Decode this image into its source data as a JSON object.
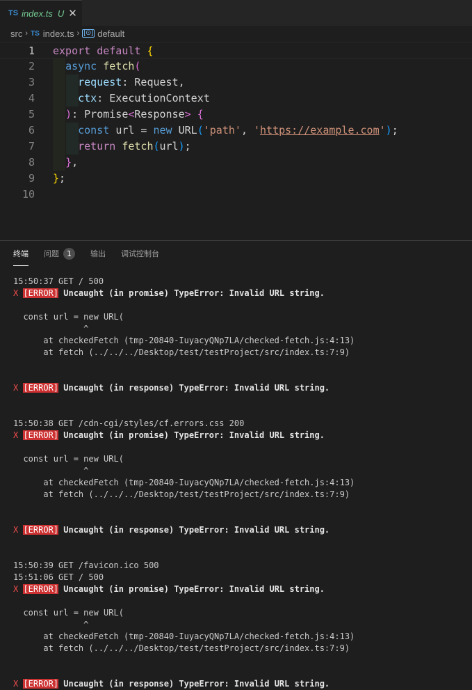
{
  "tab": {
    "badge": "TS",
    "filename": "index.ts",
    "status": "U",
    "close": "✕"
  },
  "breadcrumb": {
    "folder": "src",
    "file_badge": "TS",
    "file": "index.ts",
    "symbol_icon": "[⊙]",
    "symbol": "default"
  },
  "editor": {
    "line_numbers": [
      "1",
      "2",
      "3",
      "4",
      "5",
      "6",
      "7",
      "8",
      "9",
      "10"
    ],
    "active_line": 1,
    "lines": [
      [
        {
          "t": "export ",
          "c": "ctl"
        },
        {
          "t": "default ",
          "c": "ctl"
        },
        {
          "t": "{",
          "c": "br1"
        }
      ],
      [
        {
          "t": "  "
        },
        {
          "t": "async ",
          "c": "kw"
        },
        {
          "t": "fetch",
          "c": "fn"
        },
        {
          "t": "(",
          "c": "br2"
        }
      ],
      [
        {
          "t": "    "
        },
        {
          "t": "request",
          "c": "param"
        },
        {
          "t": ": ",
          "c": "plain"
        },
        {
          "t": "Request",
          "c": "plain"
        },
        {
          "t": ",",
          "c": "plain"
        }
      ],
      [
        {
          "t": "    "
        },
        {
          "t": "ctx",
          "c": "param"
        },
        {
          "t": ": ",
          "c": "plain"
        },
        {
          "t": "ExecutionContext",
          "c": "plain"
        }
      ],
      [
        {
          "t": "  "
        },
        {
          "t": ")",
          "c": "br2"
        },
        {
          "t": ": ",
          "c": "plain"
        },
        {
          "t": "Promise",
          "c": "plain"
        },
        {
          "t": "<",
          "c": "br2"
        },
        {
          "t": "Response",
          "c": "plain"
        },
        {
          "t": ">",
          "c": "br2"
        },
        {
          "t": " ",
          "c": "plain"
        },
        {
          "t": "{",
          "c": "br2"
        }
      ],
      [
        {
          "t": "    "
        },
        {
          "t": "const ",
          "c": "kw"
        },
        {
          "t": "url",
          "c": "plain"
        },
        {
          "t": " = ",
          "c": "plain"
        },
        {
          "t": "new ",
          "c": "kw"
        },
        {
          "t": "URL",
          "c": "plain"
        },
        {
          "t": "(",
          "c": "br3"
        },
        {
          "t": "'path'",
          "c": "str"
        },
        {
          "t": ", ",
          "c": "plain"
        },
        {
          "t": "'",
          "c": "str"
        },
        {
          "t": "https://example.com",
          "c": "str uline"
        },
        {
          "t": "'",
          "c": "str"
        },
        {
          "t": ")",
          "c": "br3"
        },
        {
          "t": ";",
          "c": "plain"
        }
      ],
      [
        {
          "t": "    "
        },
        {
          "t": "return ",
          "c": "ctl"
        },
        {
          "t": "fetch",
          "c": "fn"
        },
        {
          "t": "(",
          "c": "br3"
        },
        {
          "t": "url",
          "c": "plain"
        },
        {
          "t": ")",
          "c": "br3"
        },
        {
          "t": ";",
          "c": "plain"
        }
      ],
      [
        {
          "t": "  "
        },
        {
          "t": "}",
          "c": "br2"
        },
        {
          "t": ",",
          "c": "plain"
        }
      ],
      [
        {
          "t": "}",
          "c": "br1"
        },
        {
          "t": ";",
          "c": "plain"
        }
      ],
      []
    ]
  },
  "panel": {
    "tabs": [
      {
        "label": "终端",
        "active": true
      },
      {
        "label": "问题",
        "badge": "1"
      },
      {
        "label": "输出"
      },
      {
        "label": "调试控制台"
      }
    ]
  },
  "terminal": {
    "lines": [
      {
        "kind": "log",
        "text": "15:50:37 GET / 500"
      },
      {
        "kind": "error",
        "x": "X",
        "badge": "[ERROR]",
        "msg": "Uncaught (in promise) TypeError: Invalid URL string."
      },
      {
        "kind": "blank"
      },
      {
        "kind": "plain",
        "text": "  const url = new URL("
      },
      {
        "kind": "plain",
        "text": "              ^"
      },
      {
        "kind": "plain",
        "text": "      at checkedFetch (tmp-20840-IuyacyQNp7LA/checked-fetch.js:4:13)"
      },
      {
        "kind": "plain",
        "text": "      at fetch (../../../Desktop/test/testProject/src/index.ts:7:9)"
      },
      {
        "kind": "blank"
      },
      {
        "kind": "blank"
      },
      {
        "kind": "error",
        "x": "X",
        "badge": "[ERROR]",
        "msg": "Uncaught (in response) TypeError: Invalid URL string."
      },
      {
        "kind": "blank"
      },
      {
        "kind": "blank"
      },
      {
        "kind": "log",
        "text": "15:50:38 GET /cdn-cgi/styles/cf.errors.css 200"
      },
      {
        "kind": "error",
        "x": "X",
        "badge": "[ERROR]",
        "msg": "Uncaught (in promise) TypeError: Invalid URL string."
      },
      {
        "kind": "blank"
      },
      {
        "kind": "plain",
        "text": "  const url = new URL("
      },
      {
        "kind": "plain",
        "text": "              ^"
      },
      {
        "kind": "plain",
        "text": "      at checkedFetch (tmp-20840-IuyacyQNp7LA/checked-fetch.js:4:13)"
      },
      {
        "kind": "plain",
        "text": "      at fetch (../../../Desktop/test/testProject/src/index.ts:7:9)"
      },
      {
        "kind": "blank"
      },
      {
        "kind": "blank"
      },
      {
        "kind": "error",
        "x": "X",
        "badge": "[ERROR]",
        "msg": "Uncaught (in response) TypeError: Invalid URL string."
      },
      {
        "kind": "blank"
      },
      {
        "kind": "blank"
      },
      {
        "kind": "log",
        "text": "15:50:39 GET /favicon.ico 500"
      },
      {
        "kind": "log",
        "text": "15:51:06 GET / 500"
      },
      {
        "kind": "error",
        "x": "X",
        "badge": "[ERROR]",
        "msg": "Uncaught (in promise) TypeError: Invalid URL string."
      },
      {
        "kind": "blank"
      },
      {
        "kind": "plain",
        "text": "  const url = new URL("
      },
      {
        "kind": "plain",
        "text": "              ^"
      },
      {
        "kind": "plain",
        "text": "      at checkedFetch (tmp-20840-IuyacyQNp7LA/checked-fetch.js:4:13)"
      },
      {
        "kind": "plain",
        "text": "      at fetch (../../../Desktop/test/testProject/src/index.ts:7:9)"
      },
      {
        "kind": "blank"
      },
      {
        "kind": "blank"
      },
      {
        "kind": "error",
        "x": "X",
        "badge": "[ERROR]",
        "msg": "Uncaught (in response) TypeError: Invalid URL string."
      }
    ]
  }
}
